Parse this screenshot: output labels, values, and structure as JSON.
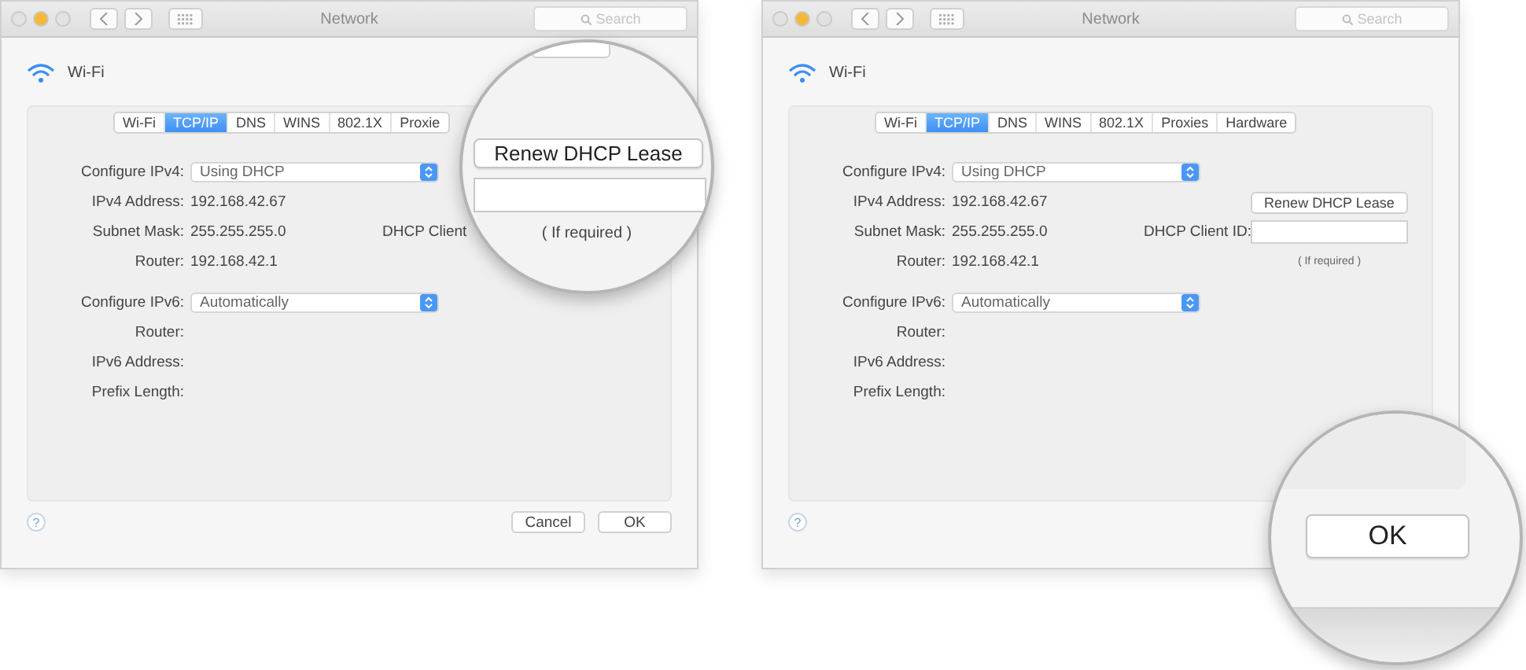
{
  "panels": [
    {
      "window": {
        "title": "Network",
        "search_placeholder": "Search"
      },
      "service": "Wi-Fi",
      "tabs": [
        {
          "label": "Wi-Fi",
          "selected": false
        },
        {
          "label": "TCP/IP",
          "selected": true
        },
        {
          "label": "DNS",
          "selected": false
        },
        {
          "label": "WINS",
          "selected": false
        },
        {
          "label": "802.1X",
          "selected": false
        },
        {
          "label": "Proxie",
          "selected": false
        }
      ],
      "fields": [
        {
          "label": "Configure IPv4:",
          "kind": "select",
          "value": "Using DHCP"
        },
        {
          "label": "IPv4 Address:",
          "kind": "text",
          "value": "192.168.42.67"
        },
        {
          "label": "Subnet Mask:",
          "kind": "text",
          "value": "255.255.255.0"
        },
        {
          "label": "Router:",
          "kind": "text",
          "value": "192.168.42.1"
        },
        {
          "label": "Configure IPv6:",
          "kind": "select",
          "value": "Automatically"
        },
        {
          "label": "Router:",
          "kind": "text"
        },
        {
          "label": "IPv6 Address:",
          "kind": "text"
        },
        {
          "label": "Prefix Length:",
          "kind": "text"
        }
      ],
      "dhcp": {
        "client_label": "DHCP Client"
      },
      "help": "?",
      "buttons": [
        "Cancel",
        "OK"
      ],
      "magnifier": {
        "kind": "dhcp",
        "renew_button": "Renew DHCP Lease",
        "hint": "( If required )"
      }
    },
    {
      "window": {
        "title": "Network",
        "search_placeholder": "Search"
      },
      "service": "Wi-Fi",
      "tabs": [
        {
          "label": "Wi-Fi",
          "selected": false
        },
        {
          "label": "TCP/IP",
          "selected": true
        },
        {
          "label": "DNS",
          "selected": false
        },
        {
          "label": "WINS",
          "selected": false
        },
        {
          "label": "802.1X",
          "selected": false
        },
        {
          "label": "Proxies",
          "selected": false
        },
        {
          "label": "Hardware",
          "selected": false
        }
      ],
      "fields": [
        {
          "label": "Configure IPv4:",
          "kind": "select",
          "value": "Using DHCP"
        },
        {
          "label": "IPv4 Address:",
          "kind": "text",
          "value": "192.168.42.67"
        },
        {
          "label": "Subnet Mask:",
          "kind": "text",
          "value": "255.255.255.0"
        },
        {
          "label": "Router:",
          "kind": "text",
          "value": "192.168.42.1"
        },
        {
          "label": "Configure IPv6:",
          "kind": "select",
          "value": "Automatically"
        },
        {
          "label": "Router:",
          "kind": "text"
        },
        {
          "label": "IPv6 Address:",
          "kind": "text"
        },
        {
          "label": "Prefix Length:",
          "kind": "text"
        }
      ],
      "dhcp": {
        "renew_button": "Renew DHCP Lease",
        "client_label": "DHCP Client ID:",
        "hint": "( If required )"
      },
      "help": "?",
      "magnifier": {
        "kind": "ok",
        "button": "OK"
      }
    }
  ]
}
